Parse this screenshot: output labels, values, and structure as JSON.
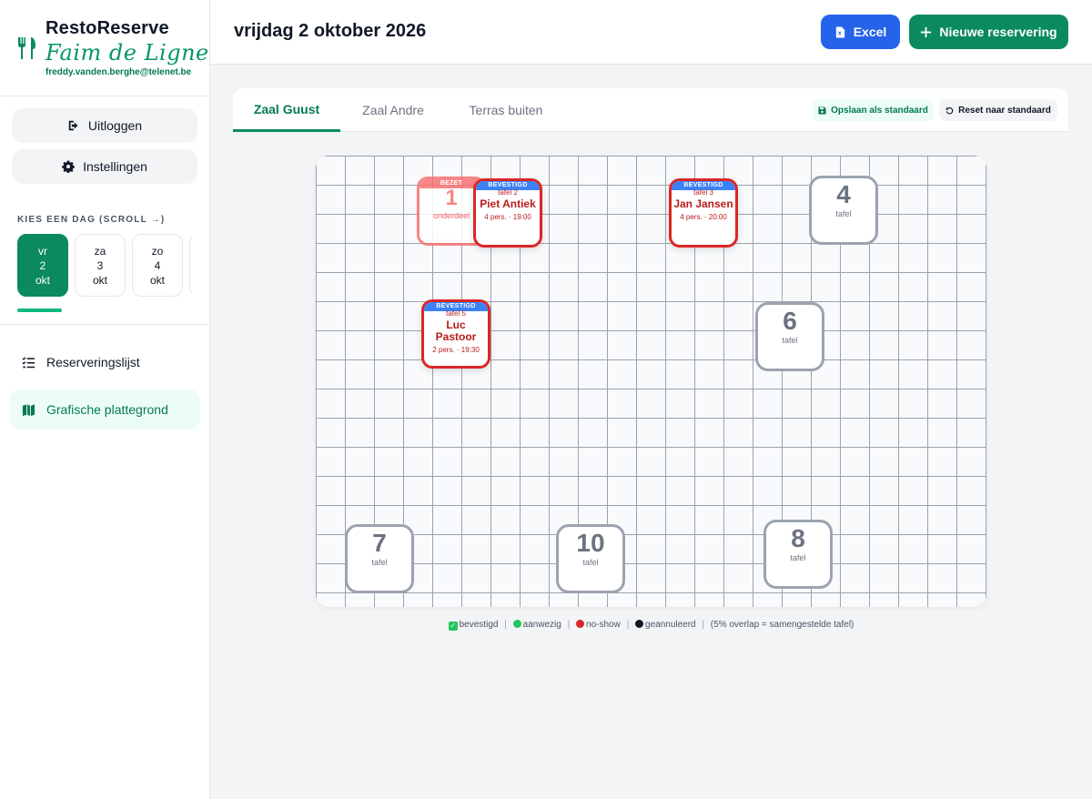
{
  "brand": {
    "title": "RestoReserve",
    "subtitle": "Faim de Ligne",
    "email": "freddy.vanden.berghe@telenet.be"
  },
  "sidebar": {
    "logout_label": "Uitloggen",
    "settings_label": "Instellingen",
    "day_picker_label": "KIES EEN DAG (SCROLL →)",
    "days": [
      {
        "weekday": "vr",
        "day": "2",
        "month": "okt",
        "active": true
      },
      {
        "weekday": "za",
        "day": "3",
        "month": "okt",
        "active": false
      },
      {
        "weekday": "zo",
        "day": "4",
        "month": "okt",
        "active": false
      }
    ],
    "nav": [
      {
        "label": "Reserveringslijst",
        "icon": "list-icon",
        "active": false
      },
      {
        "label": "Grafische plattegrond",
        "icon": "map-icon",
        "active": true
      }
    ]
  },
  "header": {
    "date": "vrijdag 2 oktober 2026",
    "excel_label": "Excel",
    "new_label": "Nieuwe reservering"
  },
  "tabs": [
    {
      "label": "Zaal Guust",
      "active": true
    },
    {
      "label": "Zaal Andre",
      "active": false
    },
    {
      "label": "Terras buiten",
      "active": false
    }
  ],
  "actions": {
    "save_default": "Opslaan als standaard",
    "reset_default": "Reset naar standaard"
  },
  "floor": {
    "occupied": {
      "status": "BEZET",
      "number": "1",
      "label": "onderdeel"
    },
    "reservations": [
      {
        "status": "BEVESTIGD",
        "table": "tafel 2",
        "name": "Piet Antiek",
        "info": "4 pers. · 19:00"
      },
      {
        "status": "BEVESTIGD",
        "table": "tafel 3",
        "name": "Jan Jansen",
        "info": "4 pers. · 20:00"
      },
      {
        "status": "BEVESTIGD",
        "table": "tafel 5",
        "name": "Luc Pastoor",
        "info": "2 pers. · 19:30"
      }
    ],
    "tables": [
      {
        "number": "4",
        "label": "tafel"
      },
      {
        "number": "6",
        "label": "tafel"
      },
      {
        "number": "7",
        "label": "tafel"
      },
      {
        "number": "10",
        "label": "tafel"
      },
      {
        "number": "8",
        "label": "tafel"
      }
    ]
  },
  "legend": {
    "confirmed": "bevestigd",
    "present": "aanwezig",
    "noshow": "no-show",
    "cancelled": "geannuleerd",
    "note": "(5% overlap = samengestelde tafel)"
  },
  "colors": {
    "brand_green": "#0b8a5e",
    "excel_blue": "#2563eb",
    "confirmed_header": "#3b82f6",
    "reservation_border": "#dc2626"
  }
}
